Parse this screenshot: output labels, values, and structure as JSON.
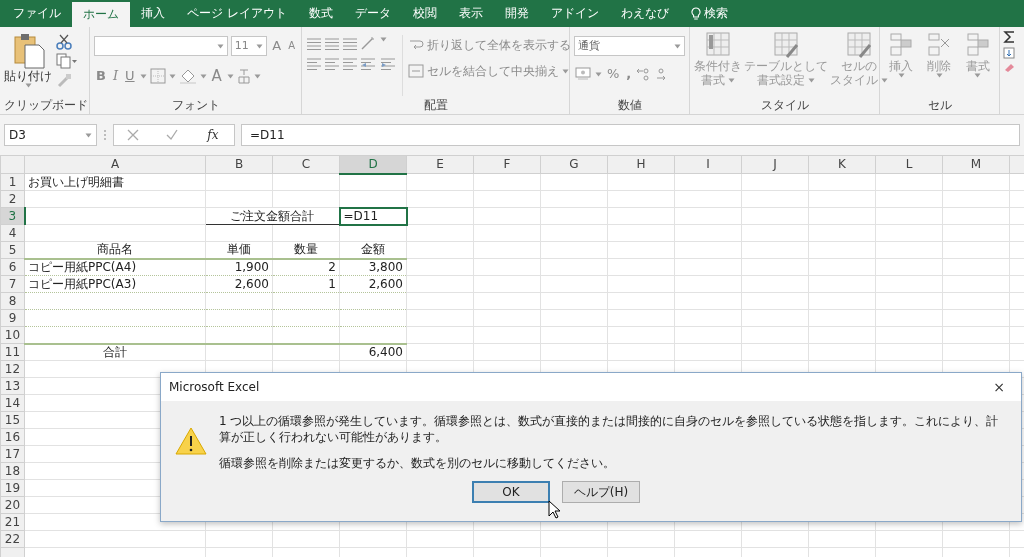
{
  "tabs": [
    {
      "label": "ファイル",
      "selected": false
    },
    {
      "label": "ホーム",
      "selected": true
    },
    {
      "label": "挿入",
      "selected": false
    },
    {
      "label": "ページ レイアウト",
      "selected": false
    },
    {
      "label": "数式",
      "selected": false
    },
    {
      "label": "データ",
      "selected": false
    },
    {
      "label": "校閲",
      "selected": false
    },
    {
      "label": "表示",
      "selected": false
    },
    {
      "label": "開発",
      "selected": false
    },
    {
      "label": "アドイン",
      "selected": false
    },
    {
      "label": "わえなび",
      "selected": false
    }
  ],
  "tell_me": {
    "label": "検索"
  },
  "ribbon": {
    "clipboard": {
      "paste": "貼り付け",
      "title": "クリップボード"
    },
    "font": {
      "size": "11",
      "grow": "A",
      "shrink": "A",
      "bold": "B",
      "italic": "I",
      "underline": "U",
      "font_color": "A",
      "title": "フォント"
    },
    "alignment": {
      "wrap": "折り返して全体を表示する",
      "merge": "セルを結合して中央揃え",
      "title": "配置"
    },
    "number": {
      "format": "通貨",
      "percent": "%",
      "comma": ",",
      "title": "数値"
    },
    "styles": {
      "buttons": [
        {
          "lines": [
            "条件付き",
            "書式"
          ]
        },
        {
          "lines": [
            "テーブルとして",
            "書式設定"
          ]
        },
        {
          "lines": [
            "セルの",
            "スタイル"
          ]
        }
      ],
      "title": "スタイル"
    },
    "cells": {
      "buttons": [
        "挿入",
        "削除",
        "書式"
      ],
      "title": "セル"
    }
  },
  "formula_bar": {
    "name_box": "D3",
    "fx": "fx",
    "formula": "=D11"
  },
  "sheet": {
    "columns": [
      {
        "label": "A",
        "selected": false
      },
      {
        "label": "B",
        "selected": false
      },
      {
        "label": "C",
        "selected": false
      },
      {
        "label": "D",
        "selected": true
      },
      {
        "label": "E",
        "selected": false
      },
      {
        "label": "F",
        "selected": false
      },
      {
        "label": "G",
        "selected": false
      },
      {
        "label": "H",
        "selected": false
      },
      {
        "label": "I",
        "selected": false
      },
      {
        "label": "J",
        "selected": false
      },
      {
        "label": "K",
        "selected": false
      },
      {
        "label": "L",
        "selected": false
      },
      {
        "label": "M",
        "selected": false
      }
    ],
    "rows": [
      {
        "number": "1",
        "kind": "title",
        "selected": false,
        "a": "お買い上げ明細書"
      },
      {
        "number": "2",
        "kind": "blank",
        "selected": false
      },
      {
        "number": "3",
        "kind": "box",
        "selected": true,
        "bc": "ご注文金額合計",
        "d": "=D11"
      },
      {
        "number": "4",
        "kind": "blank",
        "selected": false
      },
      {
        "number": "5",
        "kind": "header",
        "selected": false,
        "a": "商品名",
        "b": "単価",
        "c": "数量",
        "d": "金額"
      },
      {
        "number": "6",
        "kind": "item",
        "selected": false,
        "a": "コピー用紙PPC(A4)",
        "b": "1,900",
        "c": "2",
        "d": "3,800"
      },
      {
        "number": "7",
        "kind": "item",
        "selected": false,
        "a": "コピー用紙PPC(A3)",
        "b": "2,600",
        "c": "1",
        "d": "2,600"
      },
      {
        "number": "8",
        "kind": "item",
        "selected": false
      },
      {
        "number": "9",
        "kind": "item",
        "selected": false
      },
      {
        "number": "10",
        "kind": "item",
        "selected": false
      },
      {
        "number": "11",
        "kind": "total",
        "selected": false,
        "a": "合計",
        "d": "6,400"
      },
      {
        "number": "12",
        "kind": "blank",
        "selected": false
      },
      {
        "number": "13",
        "kind": "blank",
        "selected": false
      },
      {
        "number": "14",
        "kind": "blank",
        "selected": false
      },
      {
        "number": "15",
        "kind": "blank",
        "selected": false
      },
      {
        "number": "16",
        "kind": "blank",
        "selected": false
      },
      {
        "number": "17",
        "kind": "blank",
        "selected": false
      },
      {
        "number": "18",
        "kind": "blank",
        "selected": false
      },
      {
        "number": "19",
        "kind": "blank",
        "selected": false
      },
      {
        "number": "20",
        "kind": "blank",
        "selected": false
      },
      {
        "number": "21",
        "kind": "blank",
        "selected": false
      },
      {
        "number": "22",
        "kind": "blank",
        "selected": false
      }
    ]
  },
  "dialog": {
    "title": "Microsoft Excel",
    "close": "×",
    "messages": [
      "1 つ以上の循環参照が発生しています。循環参照とは、数式が直接的または間接的に自身のセルを参照している状態を指します。これにより、計算が正しく行われない可能性があります。",
      "循環参照を削除または変更するか、数式を別のセルに移動してください。"
    ],
    "buttons": [
      {
        "label": "OK",
        "kind": "default"
      },
      {
        "label": "ヘルプ(H)",
        "kind": "normal"
      }
    ]
  }
}
